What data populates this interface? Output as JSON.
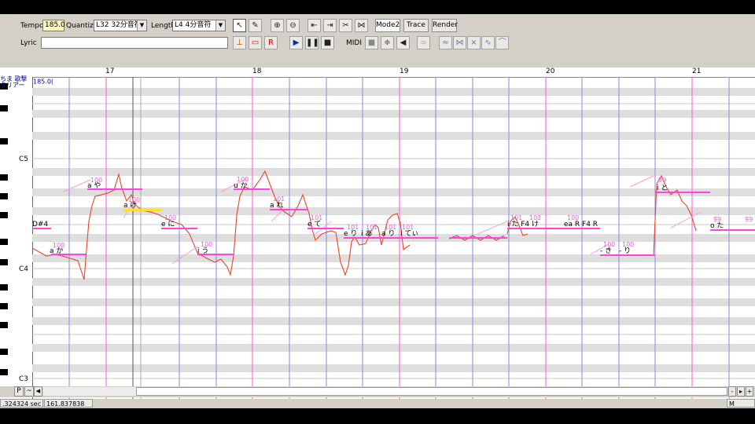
{
  "toolbar": {
    "tempo_label": "Tempo",
    "tempo_value": "185.0",
    "quantize_label": "Quantize",
    "quantize_value": "L32 32分音符",
    "length_label": "Length",
    "length_value": "L4  4分音符",
    "mode2_label": "Mode2",
    "trace_label": "Trace",
    "render_label": "Render",
    "lyric_label": "Lyric",
    "lyric_value": "",
    "midi_label": "MIDI"
  },
  "track_header": {
    "line1": "ちま 歌撃",
    "line2": "タリアー",
    "tempo_marker": "185.0("
  },
  "ruler": {
    "measures": [
      "17",
      "18",
      "19",
      "20",
      "21"
    ]
  },
  "piano": {
    "labels": [
      "C5",
      "D#4",
      "C4",
      "C3"
    ]
  },
  "notes": [
    {
      "lyric": "a か",
      "vel": "100"
    },
    {
      "lyric": "a や",
      "vel": "100"
    },
    {
      "lyric": "a け",
      "vel": "100"
    },
    {
      "lyric": "e に",
      "vel": "100"
    },
    {
      "lyric": "i う",
      "vel": "100"
    },
    {
      "lyric": "u か",
      "vel": "100"
    },
    {
      "lyric": "a れ",
      "vel": "101"
    },
    {
      "lyric": "e て",
      "vel": "101"
    },
    {
      "lyric": "e り",
      "vel": "101"
    },
    {
      "lyric": "i あ",
      "vel": "101"
    },
    {
      "lyric": "a り",
      "vel": "101"
    },
    {
      "lyric": "i てぃ",
      "vel": "101"
    },
    {
      "lyric": "i た F4 け",
      "vel": "101"
    },
    {
      "lyric": "",
      "vel": "102"
    },
    {
      "lyric": "ea R F4 R",
      "vel": "100"
    },
    {
      "lyric": "- き",
      "vel": "100"
    },
    {
      "lyric": "- り",
      "vel": "100"
    },
    {
      "lyric": "i と",
      "vel": "99"
    },
    {
      "lyric": "o た",
      "vel": "99"
    },
    {
      "lyric": "",
      "vel": "99"
    }
  ],
  "scroll": {
    "p_label": "P",
    "m_label": "M"
  },
  "status": {
    "left": ".324324 sec",
    "right": "161.837838 sec"
  },
  "colors": {
    "note": "#ff44dd",
    "note_sel": "#ffdd33",
    "pitch": "#e8452a",
    "vibrato": "#cc3333",
    "measure_line": "#ff55cc",
    "beat_line": "#8888dd"
  }
}
